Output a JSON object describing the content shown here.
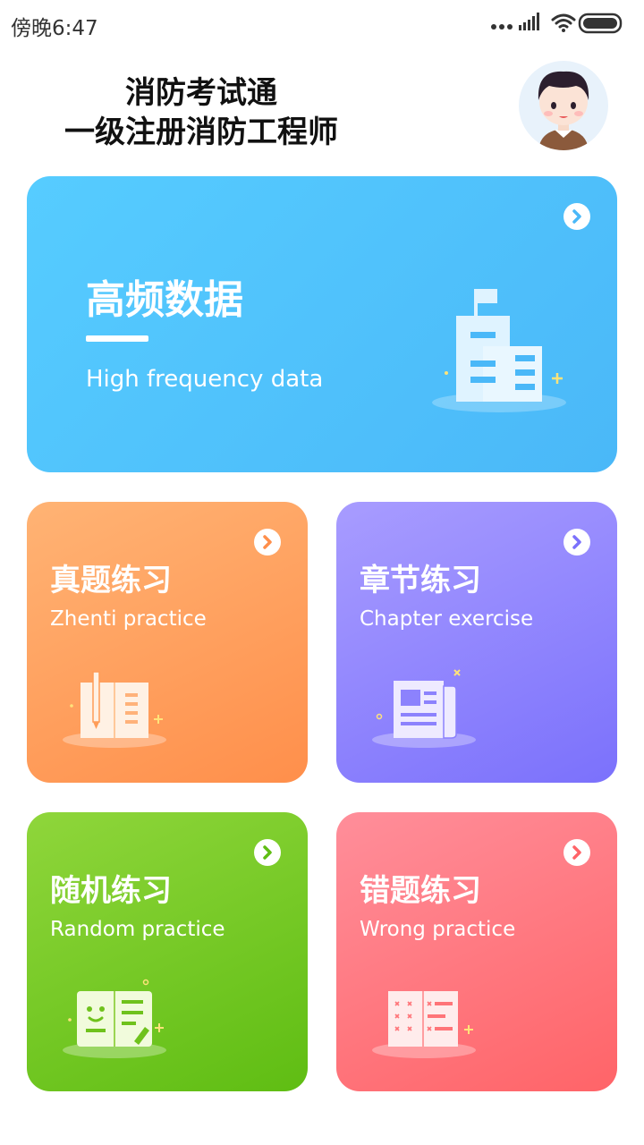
{
  "status_bar": {
    "time": "傍晚6:47"
  },
  "header": {
    "title_line1": "消防考试通",
    "title_line2": "一级注册消防工程师"
  },
  "cards": {
    "high_freq": {
      "title": "高频数据",
      "subtitle": "High frequency data",
      "icon": "building-icon"
    },
    "zhenti": {
      "title": "真题练习",
      "subtitle": "Zhenti practice",
      "icon": "book-pen-icon"
    },
    "chapter": {
      "title": "章节练习",
      "subtitle": "Chapter exercise",
      "icon": "newspaper-icon"
    },
    "random": {
      "title": "随机练习",
      "subtitle": "Random practice",
      "icon": "smiley-book-icon"
    },
    "wrong": {
      "title": "错题练习",
      "subtitle": "Wrong practice",
      "icon": "error-book-icon"
    }
  },
  "colors": {
    "high_freq": "#4ab8f8",
    "zhenti": "#ff8f4b",
    "chapter": "#7b71fc",
    "random": "#5fbd13",
    "wrong": "#ff6468"
  }
}
